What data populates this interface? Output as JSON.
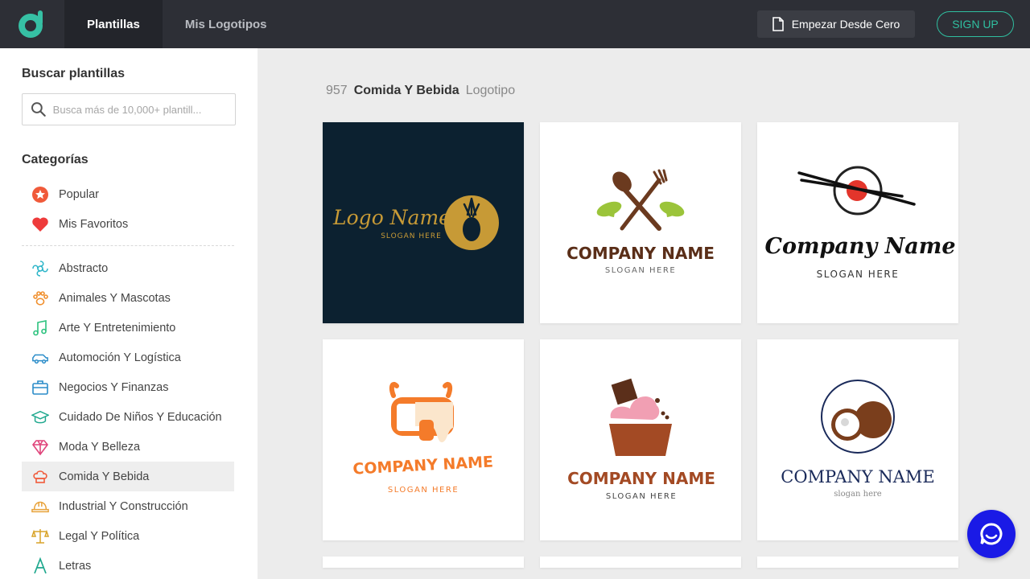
{
  "nav": {
    "tabs": [
      {
        "label": "Plantillas",
        "active": true
      },
      {
        "label": "Mis Logotipos",
        "active": false
      }
    ],
    "scratch_label": "Empezar Desde Cero",
    "signup_label": "SIGN UP"
  },
  "sidebar": {
    "search_heading": "Buscar plantillas",
    "search_placeholder": "Busca más de 10,000+ plantill...",
    "categories_heading": "Categorías",
    "top_items": [
      {
        "label": "Popular",
        "icon": "star-icon"
      },
      {
        "label": "Mis Favoritos",
        "icon": "heart-icon"
      }
    ],
    "items": [
      {
        "label": "Abstracto",
        "icon": "abstract-icon"
      },
      {
        "label": "Animales Y Mascotas",
        "icon": "paw-icon"
      },
      {
        "label": "Arte Y Entretenimiento",
        "icon": "music-note-icon"
      },
      {
        "label": "Automoción Y Logística",
        "icon": "car-icon"
      },
      {
        "label": "Negocios Y Finanzas",
        "icon": "briefcase-icon"
      },
      {
        "label": "Cuidado De Niños Y Educación",
        "icon": "graduation-cap-icon"
      },
      {
        "label": "Moda Y Belleza",
        "icon": "diamond-icon"
      },
      {
        "label": "Comida Y Bebida",
        "icon": "chef-hat-icon",
        "active": true
      },
      {
        "label": "Industrial Y Construcción",
        "icon": "hard-hat-icon"
      },
      {
        "label": "Legal Y Política",
        "icon": "scales-icon"
      },
      {
        "label": "Letras",
        "icon": "letter-a-icon"
      }
    ]
  },
  "results": {
    "count": "957",
    "category": "Comida Y Bebida",
    "kind": "Logotipo"
  },
  "cards": [
    {
      "name": "Logo Name",
      "slogan": "SLOGAN HERE"
    },
    {
      "name": "COMPANY NAME",
      "slogan": "SLOGAN HERE"
    },
    {
      "name": "Company Name",
      "slogan": "SLOGAN HERE"
    },
    {
      "name": "COMPANY NAME",
      "slogan": "SLOGAN HERE"
    },
    {
      "name": "COMPANY NAME",
      "slogan": "SLOGAN HERE"
    },
    {
      "name": "COMPANY NAME",
      "slogan": "slogan here"
    }
  ],
  "colors": {
    "topbar": "#2d2f36",
    "accent": "#2fbfa0",
    "chat": "#1a1ae6"
  }
}
